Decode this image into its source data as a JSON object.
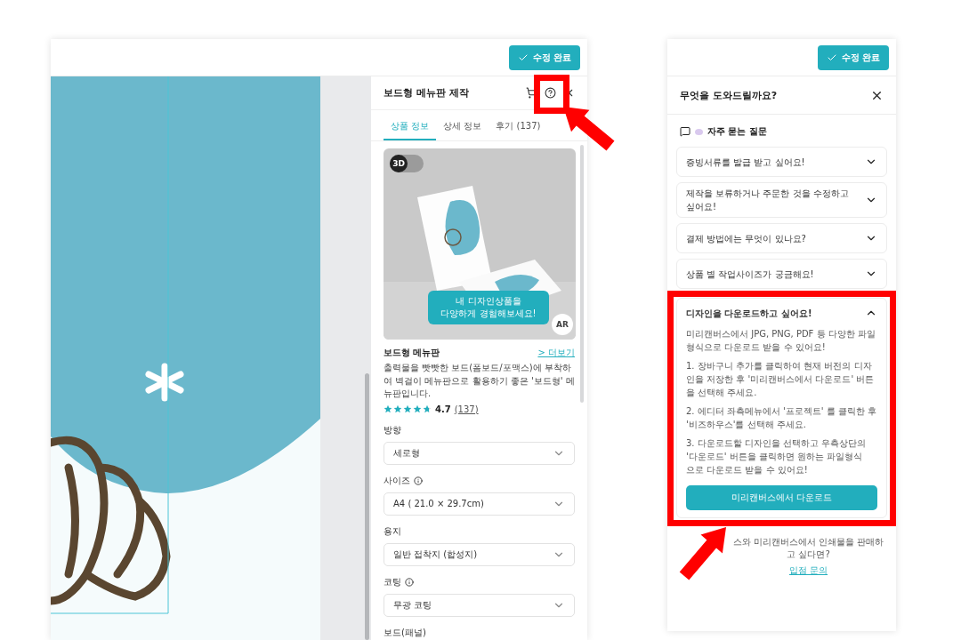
{
  "editor": {
    "done_button": "수정 완료",
    "panel": {
      "title": "보드형 메뉴판 제작",
      "tabs": [
        {
          "label": "상품 정보",
          "selected": true
        },
        {
          "label": "상세 정보",
          "selected": false
        },
        {
          "label": "후기 (137)",
          "selected": false
        }
      ],
      "preview": {
        "kind": "picture",
        "toggle_label": "3D",
        "toggle_on": false,
        "bubble": "내 디자인상품을\n다양하게 경험해보세요!",
        "ar_button": "AR"
      },
      "product": {
        "name": "보드형 메뉴판",
        "more_link": "> 더보기",
        "description": "출력물을 빳빳한 보드(폼보드/포맥스)에 부착하여 벽걸이 메뉴판으로 활용하기 좋은 '보드형' 메뉴판입니다.",
        "stars": 4.7,
        "rating": "4.7",
        "review_count": "(137)"
      },
      "options": [
        {
          "label": "방향",
          "info": false,
          "value": "세로형"
        },
        {
          "label": "사이즈",
          "info": true,
          "value": "A4 ( 21.0 × 29.7cm)"
        },
        {
          "label": "용지",
          "info": false,
          "value": "일반 접착지 (합성지)"
        },
        {
          "label": "코팅",
          "info": true,
          "value": "무광 코팅"
        }
      ],
      "cut_label": "보드(패널)"
    }
  },
  "help": {
    "done_button": "수정 완료",
    "title": "무엇을 도와드릴까요?",
    "faq_heading": "자주 묻는 질문",
    "faq": [
      {
        "question": "증빙서류를 발급 받고 싶어요!",
        "expanded": false
      },
      {
        "question": "제작을 보류하거나 주문한 것을 수정하고 싶어요!",
        "expanded": false
      },
      {
        "question": "결제 방법에는 무엇이 있나요?",
        "expanded": false
      },
      {
        "question": "상품 별 작업사이즈가 궁금해요!",
        "expanded": false
      },
      {
        "question": "디자인을 다운로드하고 싶어요!",
        "expanded": true,
        "answer": [
          "미리캔버스에서 JPG, PNG, PDF 등 다양한 파일형식으로 다운로드 받을 수 있어요!",
          "1. 장바구니 추가를 클릭하여 현재 버전의 디자인을 저장한 후 '미리캔버스에서 다운로드' 버튼을 선택해 주세요.",
          "2. 에디터 좌측메뉴에서 '프로젝트' 를 클릭한 후 '비즈하우스'를 선택해 주세요.",
          "3. 다운로드할 디자인을 선택하고 우측상단의 '다운로드' 버튼을 클릭하면 원하는 파일형식\n으로 다운로드 받을 수 있어요!"
        ],
        "button": "미리캔버스에서 다운로드"
      }
    ],
    "footer_text": "스와 미리캔버스에서 인쇄물을 판매하고 싶다면?",
    "footer_link": "입점 문의"
  }
}
